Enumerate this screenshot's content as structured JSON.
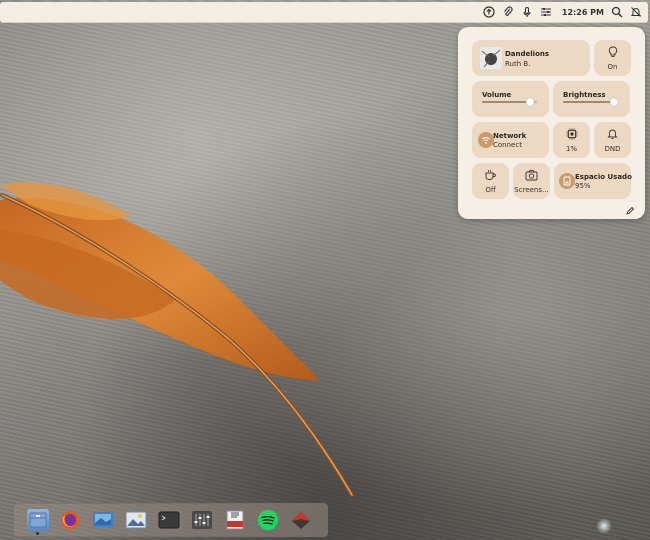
{
  "topbar": {
    "clock": "12:26 PM",
    "tray_icons": [
      "upload-icon",
      "paperclip-icon",
      "microphone-icon",
      "sliders-icon",
      "search-icon",
      "notifications-off-icon"
    ]
  },
  "quick_settings": {
    "media": {
      "title": "Dandelions",
      "artist": "Ruth B."
    },
    "light": {
      "label": "On"
    },
    "volume": {
      "label": "Volume",
      "level": 0.88
    },
    "brightness": {
      "label": "Brightness",
      "level": 0.92
    },
    "network": {
      "label": "Network",
      "status": "Connect"
    },
    "cpu": {
      "label": "1%"
    },
    "dnd": {
      "label": "DND"
    },
    "caffeine": {
      "label": "Off"
    },
    "screenshot": {
      "label": "Screens..."
    },
    "disk": {
      "label": "Espacio Usado",
      "value": "95%"
    },
    "edit_icon": "pencil-icon"
  },
  "dock": {
    "apps": [
      "files-icon",
      "firefox-icon",
      "desktop-viewer-icon",
      "image-viewer-icon",
      "terminal-icon",
      "mixer-icon",
      "archive-icon",
      "spotify-icon",
      "inkscape-icon"
    ],
    "active_app": "files-icon"
  },
  "colors": {
    "panel": "#f6efe5",
    "tile": "#ecd9c3",
    "accent_feather": "#d8782a"
  }
}
